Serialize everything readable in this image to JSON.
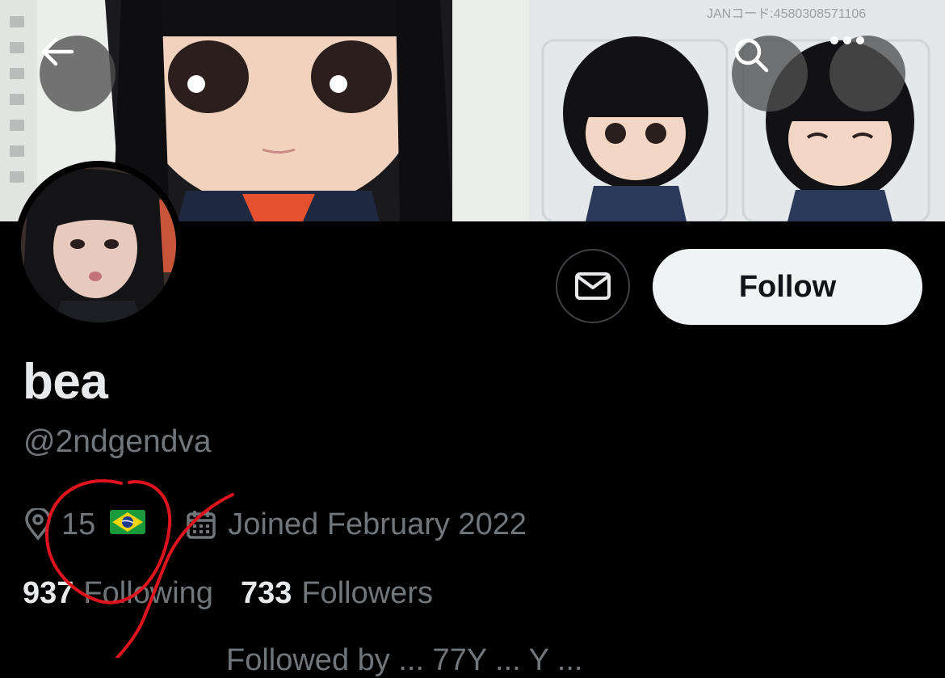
{
  "header": {
    "back_icon": "arrow-left-icon",
    "search_icon": "search-icon",
    "more_icon": "more-horizontal-icon",
    "banner_text": "JANコード:4580308571106"
  },
  "profile": {
    "display_name": "bea",
    "handle": "@2ndgendva",
    "location": "15 ",
    "location_flag": "🇧🇷",
    "joined": "Joined February 2022",
    "following_count": "937",
    "following_label": "Following",
    "followers_count": "733",
    "followers_label": "Followers",
    "followed_by_partial": "Followed by ... 77Y ... Y ..."
  },
  "actions": {
    "message_icon": "mail-icon",
    "follow_label": "Follow"
  },
  "colors": {
    "background": "#000000",
    "primary_text": "#e7e9ea",
    "secondary_text": "#71767b",
    "follow_bg": "#eff3f4",
    "annotation": "#e0141e"
  }
}
